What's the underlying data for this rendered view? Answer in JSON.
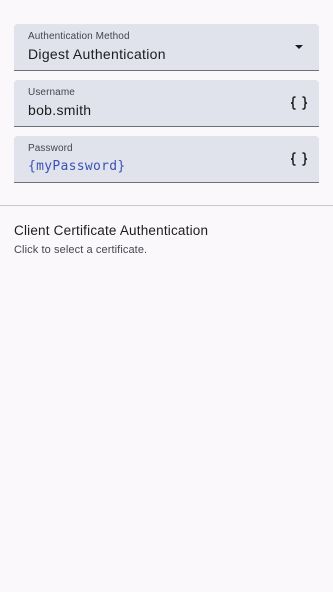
{
  "auth_method": {
    "label": "Authentication Method",
    "value": "Digest Authentication",
    "icon": "dropdown-arrow-icon"
  },
  "username": {
    "label": "Username",
    "value": "bob.smith",
    "icon": "curly-braces-icon"
  },
  "password": {
    "label": "Password",
    "value": "{myPassword}",
    "icon": "curly-braces-icon"
  },
  "client_certificate": {
    "title": "Client Certificate Authentication",
    "subtitle": "Click to select a certificate."
  },
  "colors": {
    "background": "#fbf8fc",
    "field_fill": "#e0e3ec",
    "variable_text": "#3a52b8"
  }
}
